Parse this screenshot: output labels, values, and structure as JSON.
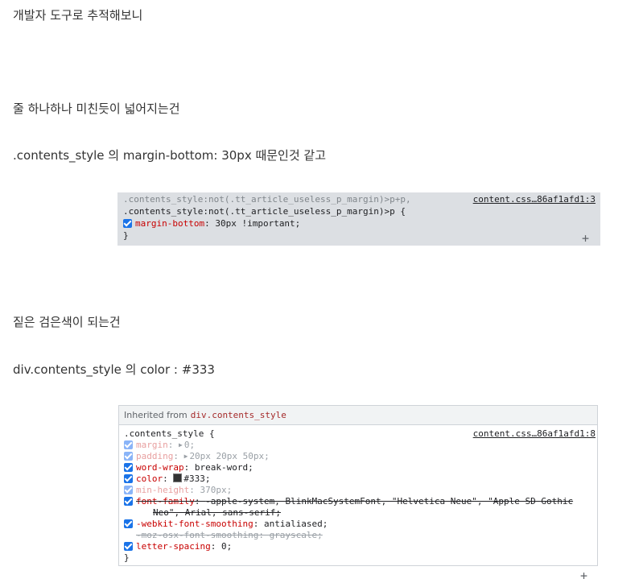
{
  "paragraphs": {
    "p1": "개발자 도구로 추적해보니",
    "p2": "줄 하나하나 미친듯이 넓어지는건",
    "p3": ".contents_style 의 margin-bottom: 30px 때문인것 같고",
    "p4": "짙은 검은색이 되는건",
    "p5": "div.contents_style 의 color : #333"
  },
  "panel1": {
    "selector_line1": ".contents_style:not(.tt_article_useless_p_margin)>p+p,",
    "selector_line2": ".contents_style:not(.tt_article_useless_p_margin)>p {",
    "source_link": "content.css…86af1afd1:3",
    "declaration_prop": "margin-bottom",
    "declaration_value": "30px !important;",
    "close_brace": "}",
    "add_rule": "+"
  },
  "panel2": {
    "inherited_label": "Inherited from",
    "inherited_selector": "div.contents_style",
    "selector": ".contents_style {",
    "source_link": "content.css…86af1afd1:8",
    "decls": {
      "margin_prop": "margin",
      "margin_value": "0;",
      "padding_prop": "padding",
      "padding_value": "20px 20px 50px;",
      "wordwrap_prop": "word-wrap",
      "wordwrap_value": "break-word;",
      "color_prop": "color",
      "color_value": "#333;",
      "minheight_prop": "min-height",
      "minheight_value": "370px;",
      "fontfamily_prop": "font-family",
      "fontfamily_value_1": "-apple-system, BlinkMacSystemFont, \"Helvetica Neue\", \"Apple SD Gothic",
      "fontfamily_value_2": "Neo\", Arial, sans-serif;",
      "webkit_prop": "-webkit-font-smoothing",
      "webkit_value": "antialiased;",
      "moz_text": "-moz-osx-font-smoothing: grayscale;",
      "letterspacing_prop": "letter-spacing",
      "letterspacing_value": "0;"
    },
    "close_brace": "}",
    "add_rule": "+"
  },
  "colors": {
    "text": "#333333",
    "property_red": "#c80000",
    "checkbox_blue": "#1a73e8",
    "panel_gray": "#dcdfe3",
    "swatch": "#333333"
  },
  "icons": {
    "checkbox": "checked-checkbox-icon",
    "expand": "triangle-right-icon",
    "add": "plus-icon"
  }
}
